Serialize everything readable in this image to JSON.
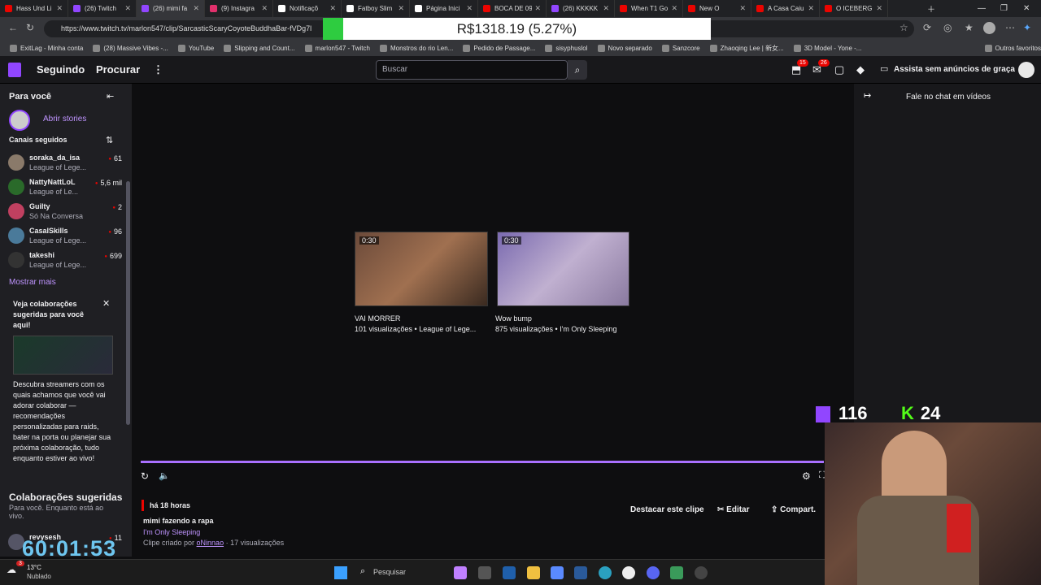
{
  "browser": {
    "tabs": [
      {
        "label": "Hass Und Li",
        "color": "#eb0400"
      },
      {
        "label": "(26) Twitch",
        "color": "#9146ff"
      },
      {
        "label": "(26) mimi fa",
        "color": "#9146ff",
        "active": true
      },
      {
        "label": "(9) Instagra",
        "color": "#e1306c"
      },
      {
        "label": "Notificaçõ",
        "color": "#ffffff"
      },
      {
        "label": "Fatboy Slim",
        "color": "#ffffff"
      },
      {
        "label": "Página Inici",
        "color": "#ffffff"
      },
      {
        "label": "BOCA DE 09",
        "color": "#eb0400"
      },
      {
        "label": "(26) KKKKK",
        "color": "#9146ff"
      },
      {
        "label": "When T1 Go",
        "color": "#eb0400"
      },
      {
        "label": "New O",
        "color": "#eb0400"
      },
      {
        "label": "A Casa Caiu",
        "color": "#eb0400"
      },
      {
        "label": "O ICEBERG",
        "color": "#eb0400"
      }
    ],
    "url": "https://www.twitch.tv/marlon547/clip/SarcasticScaryCoyoteBuddhaBar-fVDg7l",
    "price": "R$1318.19 (5.27%)",
    "bookmarks": [
      "ExitLag - Minha conta",
      "(28) Massive Vibes -...",
      "YouTube",
      "Slipping and Count...",
      "marlon547 - Twitch",
      "Monstros do rio Len...",
      "Pedido de Passage...",
      "sisyphuslol",
      "Novo separado",
      "Sanzcore",
      "Zhaoqing Lee | 新女...",
      "3D Model - Yone -...",
      "Outros favoritos"
    ]
  },
  "topnav": {
    "following": "Seguindo",
    "browse": "Procurar",
    "search_placeholder": "Buscar",
    "badge1": "15",
    "badge2": "26",
    "adfree": "Assista sem anúncios de graça"
  },
  "sidebar": {
    "for_you": "Para você",
    "stories": "Abrir stories",
    "followed": "Canais seguidos",
    "channels": [
      {
        "name": "soraka_da_isa",
        "game": "League of Lege...",
        "viewers": "61",
        "color": "#8a7a6a"
      },
      {
        "name": "NattyNattLoL",
        "game": "League of Le...",
        "viewers": "5,6 mil",
        "color": "#2a6a2a"
      },
      {
        "name": "Guilty",
        "game": "Só Na Conversa",
        "viewers": "2",
        "color": "#c04060"
      },
      {
        "name": "CasalSkills",
        "game": "League of Lege...",
        "viewers": "96",
        "color": "#4a7a9a"
      },
      {
        "name": "takeshi",
        "game": "League of Lege...",
        "viewers": "699",
        "color": "#333"
      }
    ],
    "show_more": "Mostrar mais",
    "card_title": "Veja colaborações sugeridas para você aqui!",
    "card_body": "Descubra streamers com os quais achamos que você vai adorar colaborar — recomendações personalizadas para raids, bater na porta ou planejar sua próxima colaboração, tudo enquanto estiver ao vivo!",
    "collab_title": "Colaborações sugeridas",
    "collab_sub": "Para você. Enquanto está ao vivo.",
    "collab_item": {
      "name": "revysesh",
      "viewers": "11"
    }
  },
  "player": {
    "clips": [
      {
        "duration": "0:30",
        "title": "VAI MORRER",
        "meta": "101 visualizações • League of Lege..."
      },
      {
        "duration": "0:30",
        "title": "Wow bump",
        "meta": "875 visualizações • I'm Only Sleeping"
      }
    ],
    "time_ago": "há 18 horas",
    "clip_title": "mimi fazendo a rapa",
    "category": "I'm Only Sleeping",
    "created_by": "Clipe criado por",
    "creator": "oNinnao",
    "views": "· 17 visualizações",
    "feature_btn": "Destacar este clipe",
    "edit_btn": "Editar",
    "share_btn": "Compart."
  },
  "chat": {
    "label": "Fale no chat em vídeos"
  },
  "overlay": {
    "twitch_count": "116",
    "kick_count": "24",
    "timer": "60:01:53"
  },
  "taskbar": {
    "weather_temp": "13°C",
    "weather_desc": "Nublado",
    "search": "Pesquisar",
    "weather_badge": "3"
  }
}
